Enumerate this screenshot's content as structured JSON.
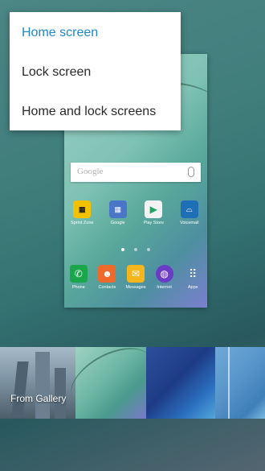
{
  "menu": {
    "items": [
      {
        "label": "Home screen",
        "selected": true
      },
      {
        "label": "Lock screen",
        "selected": false
      },
      {
        "label": "Home and lock screens",
        "selected": false
      }
    ]
  },
  "preview": {
    "search_placeholder": "Google",
    "apps_row1": [
      {
        "label": "Sprint Zone",
        "icon": "sprint-zone-icon",
        "color": "#f2c200"
      },
      {
        "label": "Google",
        "icon": "google-folder-icon",
        "color": "#4a76c8"
      },
      {
        "label": "Play Store",
        "icon": "play-store-icon",
        "color": "#ffffff"
      },
      {
        "label": "Voicemail",
        "icon": "voicemail-icon",
        "color": "#1e6fb5"
      }
    ],
    "apps_row2": [
      {
        "label": "Phone",
        "icon": "phone-icon",
        "color": "#1aa64a"
      },
      {
        "label": "Contacts",
        "icon": "contacts-icon",
        "color": "#ee6a2b"
      },
      {
        "label": "Messages",
        "icon": "messages-icon",
        "color": "#f5b51c"
      },
      {
        "label": "Internet",
        "icon": "internet-icon",
        "color": "#6a3bc4"
      },
      {
        "label": "Apps",
        "icon": "apps-grid-icon",
        "color": "#ffffff"
      }
    ],
    "page_indicator": {
      "count": 3,
      "active": 1
    }
  },
  "gallery": {
    "from_gallery_label": "From Gallery"
  }
}
